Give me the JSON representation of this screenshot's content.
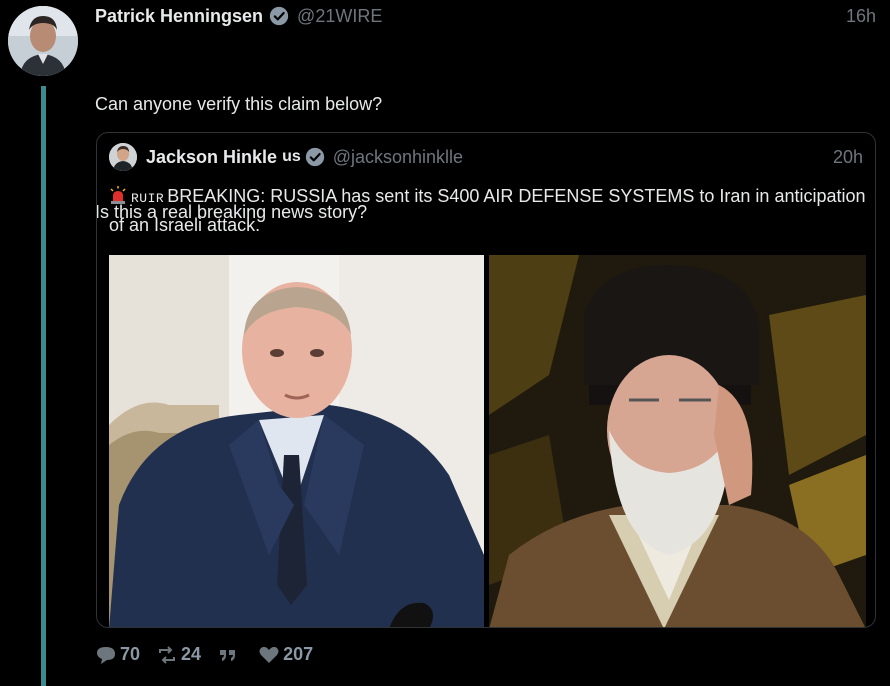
{
  "tweet": {
    "display_name": "Patrick Henningsen",
    "handle": "@21WIRE",
    "time": "16h",
    "lines": [
      "Can anyone verify this claim below?",
      "Is this a real breaking news story?"
    ]
  },
  "quote": {
    "display_name": "Jackson Hinkle",
    "name_suffix": "us",
    "handle": "@jacksonhinklle",
    "time": "20h",
    "tag": "RUIR",
    "text": "BREAKING: RUSSIA has sent its S400 AIR DEFENSE SYSTEMS to Iran in anticipation of an Israeli attack."
  },
  "actions": {
    "replies": "70",
    "retweets": "24",
    "likes": "207"
  },
  "colors": {
    "background": "#000000",
    "thread_line": "#3c8b8e",
    "verified": "#8b98a5",
    "muted": "#6e767d"
  },
  "icons": [
    "verified-badge-icon",
    "siren-icon",
    "reply-icon",
    "retweet-icon",
    "quote-icon",
    "like-icon"
  ]
}
